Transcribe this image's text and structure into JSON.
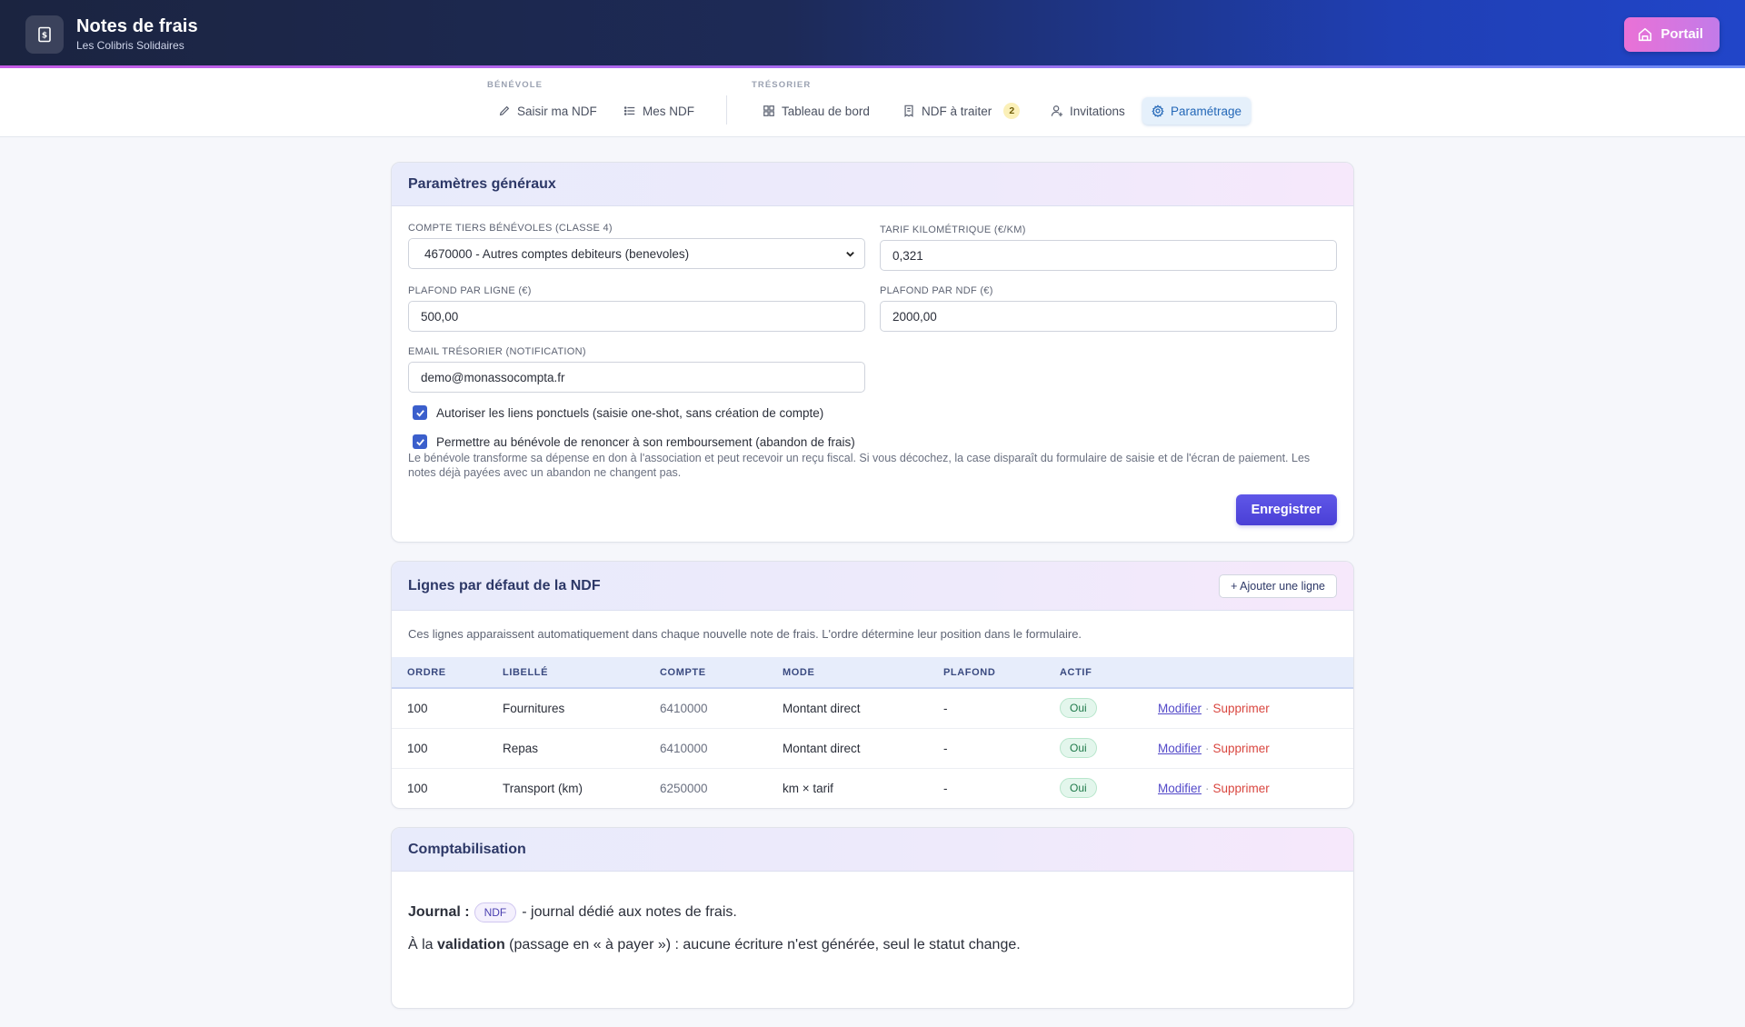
{
  "header": {
    "title": "Notes de frais",
    "subtitle": "Les Colibris Solidaires",
    "portal_label": "Portail"
  },
  "nav": {
    "group_benevole": "BÉNÉVOLE",
    "group_tresorier": "TRÉSORIER",
    "items": [
      {
        "label": "Saisir ma NDF",
        "icon": "pencil-icon"
      },
      {
        "label": "Mes NDF",
        "icon": "list-icon"
      },
      {
        "label": "Tableau de bord",
        "icon": "grid-icon"
      },
      {
        "label": "NDF à traiter",
        "icon": "receipt-icon",
        "badge": "2"
      },
      {
        "label": "Invitations",
        "icon": "user-plus-icon"
      },
      {
        "label": "Paramétrage",
        "icon": "gear-icon",
        "active": true
      }
    ]
  },
  "general": {
    "title": "Paramètres généraux",
    "compte_label": "COMPTE TIERS BÉNÉVOLES (CLASSE 4)",
    "compte_value": "4670000 - Autres comptes debiteurs (benevoles)",
    "tarif_label": "TARIF KILOMÉTRIQUE (€/KM)",
    "tarif_value": "0,321",
    "plafond_ligne_label": "PLAFOND PAR LIGNE (€)",
    "plafond_ligne_value": "500,00",
    "plafond_ndf_label": "PLAFOND PAR NDF (€)",
    "plafond_ndf_value": "2000,00",
    "email_label": "EMAIL TRÉSORIER (NOTIFICATION)",
    "email_value": "demo@monassocompta.fr",
    "check1_label": "Autoriser les liens ponctuels (saisie one-shot, sans création de compte)",
    "check2_label": "Permettre au bénévole de renoncer à son remboursement (abandon de frais)",
    "check2_hint": "Le bénévole transforme sa dépense en don à l'association et peut recevoir un reçu fiscal. Si vous décochez, la case disparaît du formulaire de saisie et de l'écran de paiement. Les notes déjà payées avec un abandon ne changent pas.",
    "save_label": "Enregistrer"
  },
  "lines": {
    "title": "Lignes par défaut de la NDF",
    "add_label": "+ Ajouter une ligne",
    "description": "Ces lignes apparaissent automatiquement dans chaque nouvelle note de frais. L'ordre détermine leur position dans le formulaire.",
    "columns": [
      "ORDRE",
      "LIBELLÉ",
      "COMPTE",
      "MODE",
      "PLAFOND",
      "ACTIF"
    ],
    "rows": [
      {
        "ordre": "100",
        "libelle": "Fournitures",
        "compte": "6410000",
        "mode": "Montant direct",
        "plafond": "-",
        "actif": "Oui"
      },
      {
        "ordre": "100",
        "libelle": "Repas",
        "compte": "6410000",
        "mode": "Montant direct",
        "plafond": "-",
        "actif": "Oui"
      },
      {
        "ordre": "100",
        "libelle": "Transport (km)",
        "compte": "6250000",
        "mode": "km × tarif",
        "plafond": "-",
        "actif": "Oui"
      }
    ],
    "edit_label": "Modifier",
    "delete_label": "Supprimer",
    "sep": "·"
  },
  "compta": {
    "title": "Comptabilisation",
    "journal_label": "Journal :",
    "journal_code": "NDF",
    "journal_text": "- journal dédié aux notes de frais.",
    "validation_prefix": "À la",
    "validation_bold": "validation",
    "validation_text": "(passage en « à payer ») : aucune écriture n'est générée, seul le statut change."
  }
}
